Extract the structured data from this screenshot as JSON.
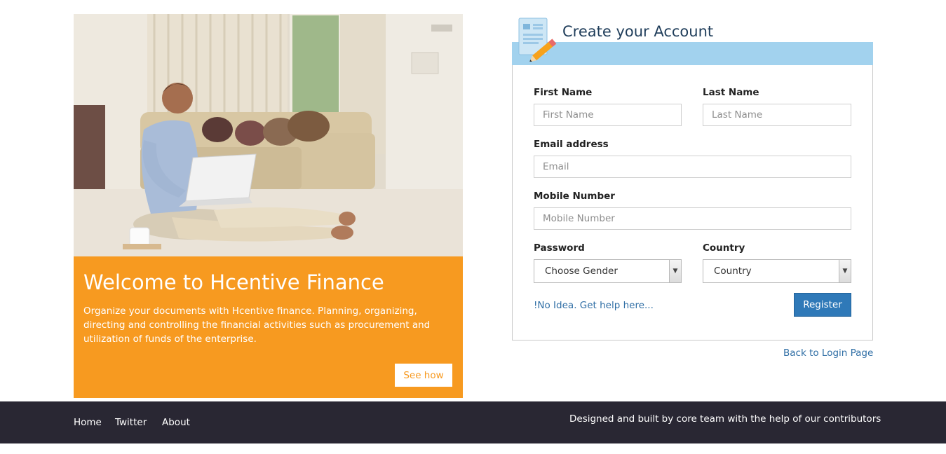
{
  "promo": {
    "image_alt": "Man working on a laptop in a living room",
    "title": "Welcome to Hcentive Finance",
    "description": "Organize your documents with Hcentive finance. Planning, organizing, directing and controlling the financial activities such as procurement and utilization of funds of the enterprise.",
    "cta_label": "See how"
  },
  "register": {
    "title": "Create your Account",
    "header_icon": "edit-document-icon",
    "first_name": {
      "label": "First Name",
      "placeholder": "First Name",
      "value": ""
    },
    "last_name": {
      "label": "Last Name",
      "placeholder": "Last Name",
      "value": ""
    },
    "email": {
      "label": "Email address",
      "placeholder": "Email",
      "value": ""
    },
    "mobile": {
      "label": "Mobile Number",
      "placeholder": "Mobile Number",
      "value": ""
    },
    "password": {
      "label": "Password",
      "selected": "Choose Gender"
    },
    "country": {
      "label": "Country",
      "selected": "Country"
    },
    "help_link": "!No Idea. Get help here...",
    "submit_label": "Register"
  },
  "back_link": "Back to Login Page",
  "footer": {
    "links": [
      "Home",
      "Twitter",
      "About"
    ],
    "credits": "Designed and built by core team with the help of our contributors"
  },
  "colors": {
    "accent_orange": "#f79a20",
    "header_band": "#a2d2ee",
    "primary_button": "#2f79b8",
    "link": "#2f6ea5",
    "footer_bg": "#292733"
  }
}
